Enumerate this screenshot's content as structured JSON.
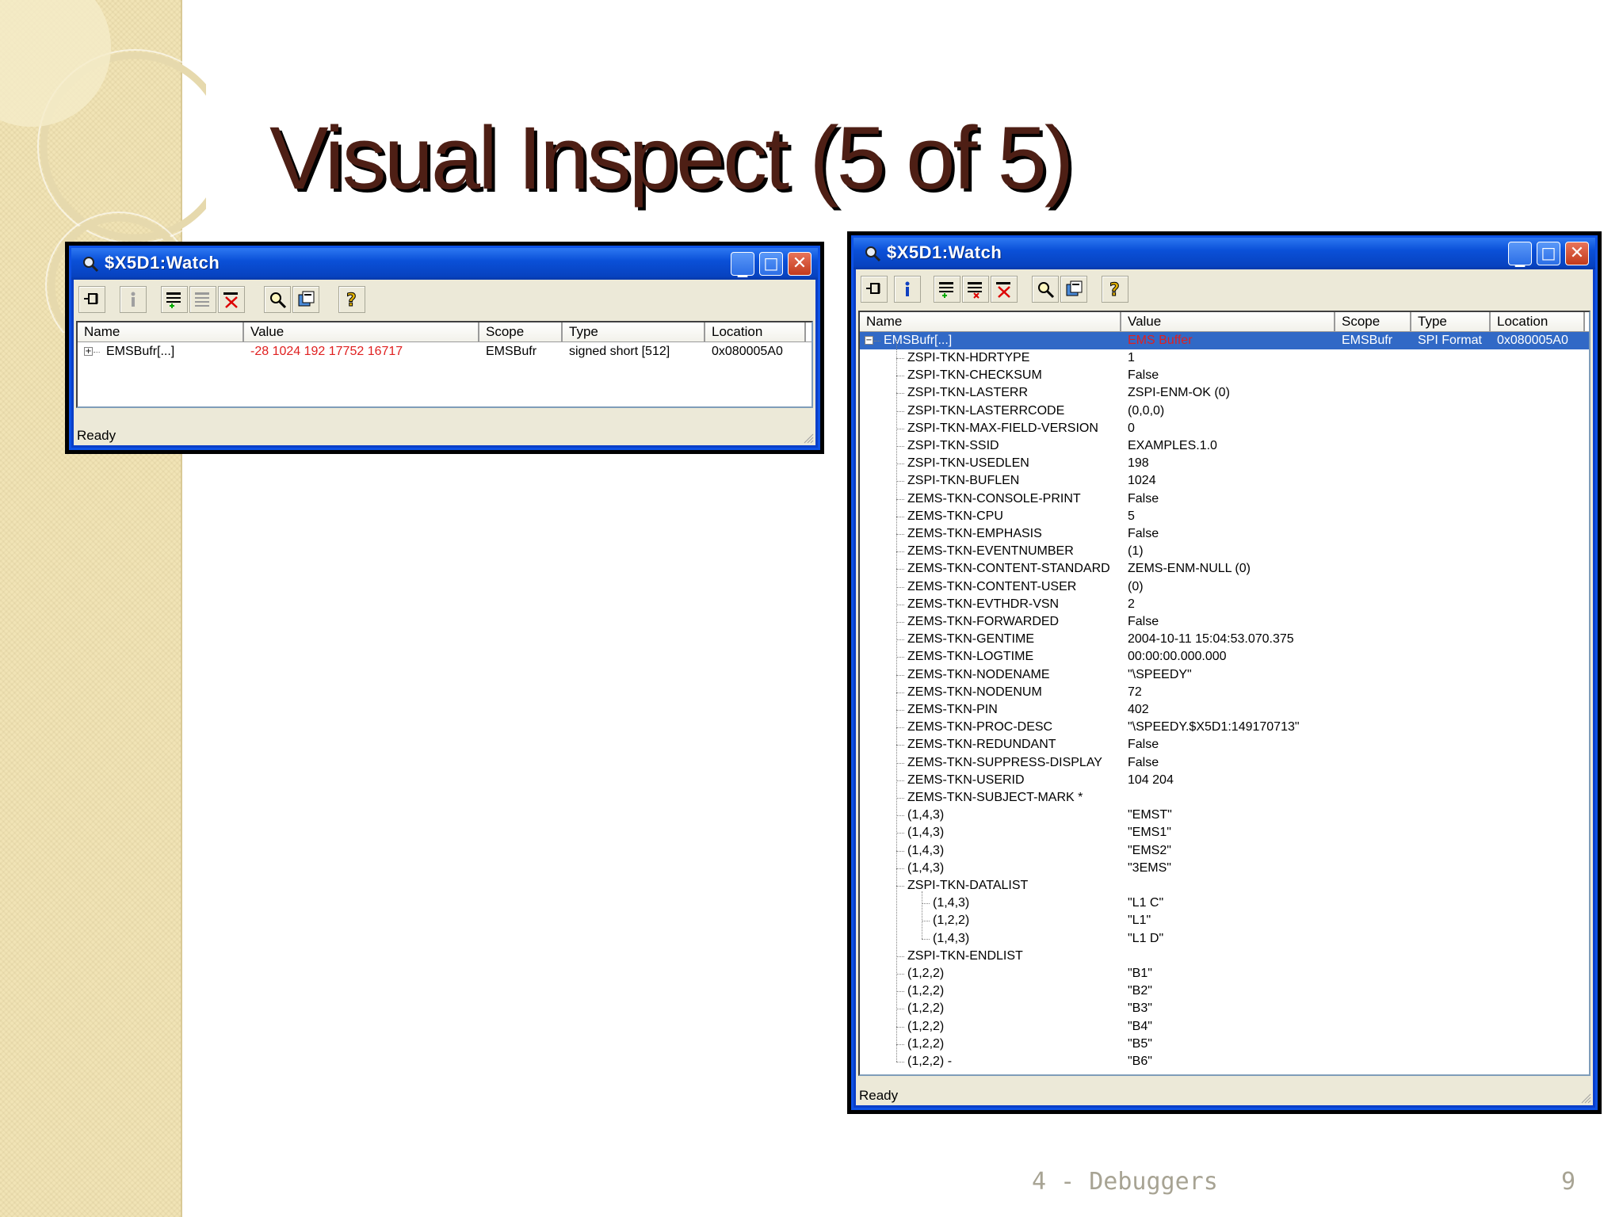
{
  "slide": {
    "title": "Visual Inspect (5 of 5)",
    "footer": "4 - Debuggers",
    "page_number": "9"
  },
  "window1": {
    "title": "$X5D1:Watch",
    "columns": [
      "Name",
      "Value",
      "Scope",
      "Type",
      "Location"
    ],
    "row": {
      "expander": "⊞",
      "name": "EMSBufr[...]",
      "value": "-28 1024 192 17752 16717",
      "scope": "EMSBufr",
      "type": "signed short [512]",
      "location": "0x080005A0"
    },
    "status": "Ready",
    "value_color": "#e02020"
  },
  "window2": {
    "title": "$X5D1:Watch",
    "columns": [
      "Name",
      "Value",
      "Scope",
      "Type",
      "Location"
    ],
    "root": {
      "expander": "⊟",
      "name": "EMSBufr[...]",
      "value": "EMS Buffer",
      "scope": "EMSBufr",
      "type": "SPI Format",
      "location": "0x080005A0"
    },
    "rows": [
      {
        "name": "ZSPI-TKN-HDRTYPE",
        "value": "1",
        "level": 1
      },
      {
        "name": "ZSPI-TKN-CHECKSUM",
        "value": "False",
        "level": 1
      },
      {
        "name": "ZSPI-TKN-LASTERR",
        "value": "ZSPI-ENM-OK  (0)",
        "level": 1
      },
      {
        "name": "ZSPI-TKN-LASTERRCODE",
        "value": "(0,0,0)",
        "level": 1
      },
      {
        "name": "ZSPI-TKN-MAX-FIELD-VERSION",
        "value": "0",
        "level": 1
      },
      {
        "name": "ZSPI-TKN-SSID",
        "value": "EXAMPLES.1.0",
        "level": 1
      },
      {
        "name": "ZSPI-TKN-USEDLEN",
        "value": "198",
        "level": 1
      },
      {
        "name": "ZSPI-TKN-BUFLEN",
        "value": "1024",
        "level": 1
      },
      {
        "name": "ZEMS-TKN-CONSOLE-PRINT",
        "value": "False",
        "level": 1
      },
      {
        "name": "ZEMS-TKN-CPU",
        "value": "5",
        "level": 1
      },
      {
        "name": "ZEMS-TKN-EMPHASIS",
        "value": "False",
        "level": 1
      },
      {
        "name": "ZEMS-TKN-EVENTNUMBER",
        "value": "(1)",
        "level": 1
      },
      {
        "name": "ZEMS-TKN-CONTENT-STANDARD",
        "value": "ZEMS-ENM-NULL  (0)",
        "level": 1
      },
      {
        "name": "ZEMS-TKN-CONTENT-USER",
        "value": "(0)",
        "level": 1
      },
      {
        "name": "ZEMS-TKN-EVTHDR-VSN",
        "value": "2",
        "level": 1
      },
      {
        "name": "ZEMS-TKN-FORWARDED",
        "value": "False",
        "level": 1
      },
      {
        "name": "ZEMS-TKN-GENTIME",
        "value": "2004-10-11 15:04:53.070.375",
        "level": 1
      },
      {
        "name": "ZEMS-TKN-LOGTIME",
        "value": "00:00:00.000.000",
        "level": 1
      },
      {
        "name": "ZEMS-TKN-NODENAME",
        "value": "\"\\SPEEDY\"",
        "level": 1
      },
      {
        "name": "ZEMS-TKN-NODENUM",
        "value": "72",
        "level": 1
      },
      {
        "name": "ZEMS-TKN-PIN",
        "value": "402",
        "level": 1
      },
      {
        "name": "ZEMS-TKN-PROC-DESC",
        "value": "\"\\SPEEDY.$X5D1:149170713\"",
        "level": 1
      },
      {
        "name": "ZEMS-TKN-REDUNDANT",
        "value": "False",
        "level": 1
      },
      {
        "name": "ZEMS-TKN-SUPPRESS-DISPLAY",
        "value": "False",
        "level": 1
      },
      {
        "name": "ZEMS-TKN-USERID",
        "value": "104 204",
        "level": 1
      },
      {
        "name": "ZEMS-TKN-SUBJECT-MARK   *",
        "value": "",
        "level": 1
      },
      {
        "name": "(1,4,3)",
        "value": "\"EMST\"",
        "level": 1
      },
      {
        "name": "(1,4,3)",
        "value": "\"EMS1\"",
        "level": 1
      },
      {
        "name": "(1,4,3)",
        "value": "\"EMS2\"",
        "level": 1
      },
      {
        "name": "(1,4,3)",
        "value": "\"3EMS\"",
        "level": 1
      },
      {
        "name": "ZSPI-TKN-DATALIST",
        "value": "",
        "level": 1
      },
      {
        "name": "(1,4,3)",
        "value": "\"L1 C\"",
        "level": 2
      },
      {
        "name": "(1,2,2)",
        "value": "\"L1\"",
        "level": 2
      },
      {
        "name": "(1,4,3)",
        "value": "\"L1 D\"",
        "level": 2
      },
      {
        "name": "ZSPI-TKN-ENDLIST",
        "value": "",
        "level": 1
      },
      {
        "name": "(1,2,2)",
        "value": "\"B1\"",
        "level": 1
      },
      {
        "name": "(1,2,2)",
        "value": "\"B2\"",
        "level": 1
      },
      {
        "name": "(1,2,2)",
        "value": "\"B3\"",
        "level": 1
      },
      {
        "name": "(1,2,2)",
        "value": "\"B4\"",
        "level": 1
      },
      {
        "name": "(1,2,2)",
        "value": "\"B5\"",
        "level": 1
      },
      {
        "name": "(1,2,2)   -",
        "value": "\"B6\"",
        "level": 1
      }
    ],
    "status": "Ready",
    "root_value_color": "#e02020"
  },
  "toolbar_icons": [
    "pin-icon",
    "info-icon",
    "add-watch-icon",
    "modify-watch-icon",
    "delete-watch-icon",
    "inspect-icon",
    "copy-icon",
    "help-icon"
  ]
}
